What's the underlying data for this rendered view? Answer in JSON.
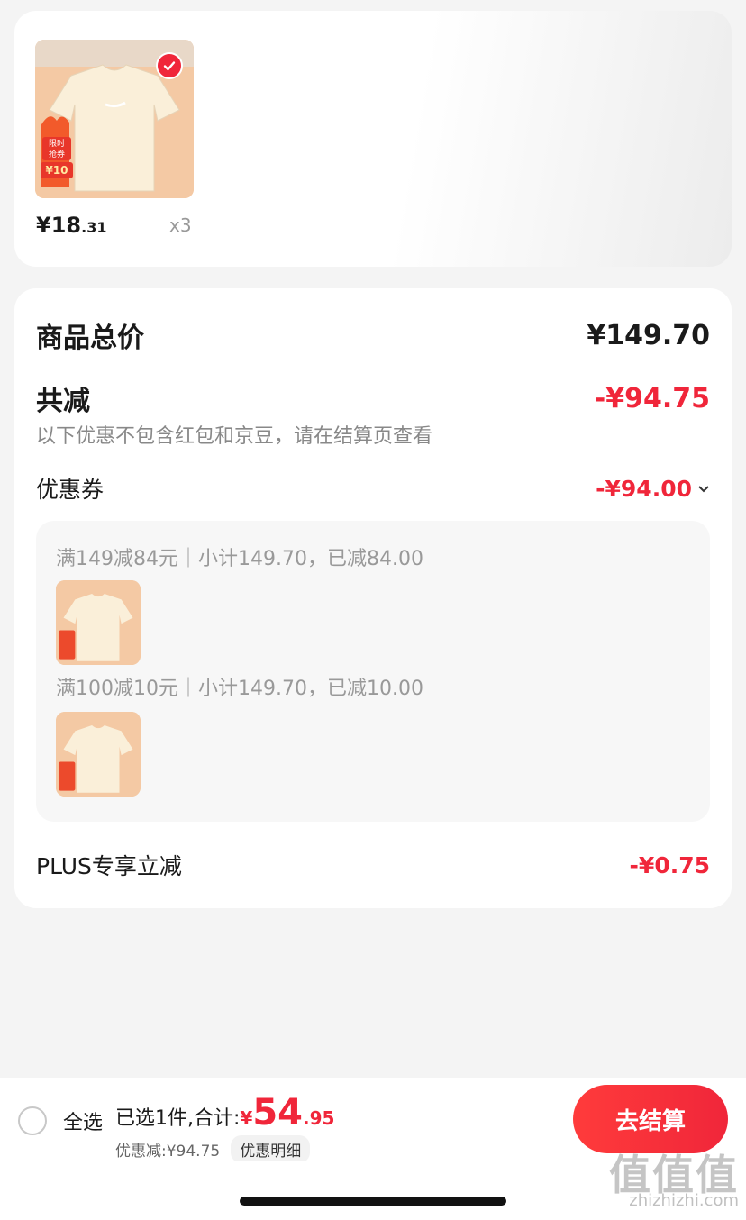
{
  "product": {
    "badge_lines": [
      "限时",
      "抢券",
      "¥10"
    ],
    "price_int": "¥18",
    "price_dec": ".31",
    "quantity": "x3",
    "selected": true
  },
  "summary_card": {
    "total_label": "商品总价",
    "total_value": "¥149.70",
    "reduce_label": "共减",
    "reduce_value": "-¥94.75",
    "note": "以下优惠不包含红包和京豆，请在结算页查看",
    "coupon_label": "优惠券",
    "coupon_value": "-¥94.00",
    "coupon_lines": [
      "满149减84元｜小计149.70，已减84.00",
      "满100减10元｜小计149.70，已减10.00"
    ],
    "plus_label": "PLUS专享立减",
    "plus_value": "-¥0.75"
  },
  "bottom_bar": {
    "select_all": "全选",
    "selected_text": "已选1件,合计:",
    "currency": "¥",
    "total_int": "54",
    "total_dec": ".95",
    "discount_text": "优惠减:¥94.75",
    "detail_button": "优惠明细",
    "checkout_button": "去结算"
  },
  "watermark": {
    "text": "值值值",
    "url": "zhizhizhi.com"
  },
  "colors": {
    "accent_red": "#f0263a",
    "background": "#f4f4f4"
  }
}
